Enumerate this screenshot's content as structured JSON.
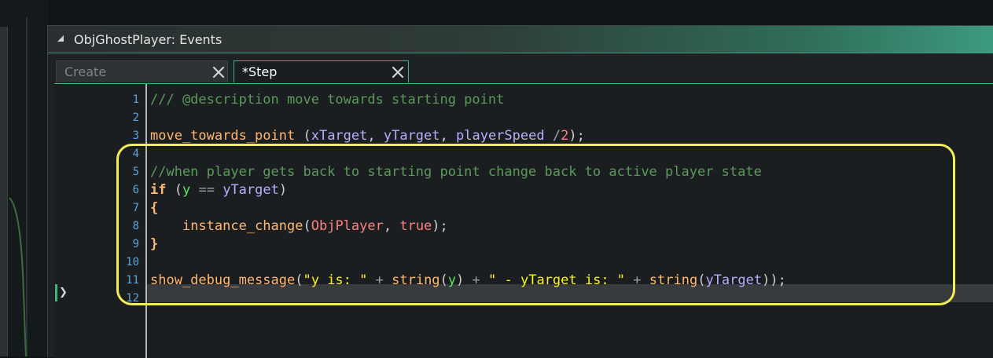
{
  "window": {
    "title": "ObjGhostPlayer: Events"
  },
  "tabs": [
    {
      "label": "Create",
      "active": false
    },
    {
      "label": "*Step",
      "active": true
    }
  ],
  "editor": {
    "line_numbers": [
      "1",
      "2",
      "3",
      "4",
      "5",
      "6",
      "7",
      "8",
      "9",
      "10",
      "11",
      "12"
    ],
    "current_line": 12,
    "lines": [
      [
        {
          "t": "comment",
          "v": "/// @description move towards starting point"
        }
      ],
      [],
      [
        {
          "t": "func",
          "v": "move_towards_point"
        },
        {
          "t": "plain",
          "v": " ("
        },
        {
          "t": "var",
          "v": "xTarget"
        },
        {
          "t": "plain",
          "v": ", "
        },
        {
          "t": "var",
          "v": "yTarget"
        },
        {
          "t": "plain",
          "v": ", "
        },
        {
          "t": "var",
          "v": "playerSpeed"
        },
        {
          "t": "plain",
          "v": " "
        },
        {
          "t": "op",
          "v": "/"
        },
        {
          "t": "num",
          "v": "2"
        },
        {
          "t": "plain",
          "v": ");"
        }
      ],
      [],
      [
        {
          "t": "comment",
          "v": "//when player gets back to starting point change back to active player state"
        }
      ],
      [
        {
          "t": "keyword",
          "v": "if"
        },
        {
          "t": "plain",
          "v": " ("
        },
        {
          "t": "builtin",
          "v": "y"
        },
        {
          "t": "plain",
          "v": " "
        },
        {
          "t": "op",
          "v": "=="
        },
        {
          "t": "plain",
          "v": " "
        },
        {
          "t": "var",
          "v": "yTarget"
        },
        {
          "t": "plain",
          "v": ")"
        }
      ],
      [
        {
          "t": "keyword",
          "v": "{"
        }
      ],
      [
        {
          "t": "plain",
          "v": "    "
        },
        {
          "t": "func",
          "v": "instance_change"
        },
        {
          "t": "plain",
          "v": "("
        },
        {
          "t": "asset",
          "v": "ObjPlayer"
        },
        {
          "t": "plain",
          "v": ", "
        },
        {
          "t": "const",
          "v": "true"
        },
        {
          "t": "plain",
          "v": ");"
        }
      ],
      [
        {
          "t": "keyword",
          "v": "}"
        }
      ],
      [],
      [
        {
          "t": "func",
          "v": "show_debug_message"
        },
        {
          "t": "plain",
          "v": "("
        },
        {
          "t": "string",
          "v": "\"y is: \""
        },
        {
          "t": "plain",
          "v": " "
        },
        {
          "t": "op",
          "v": "+"
        },
        {
          "t": "plain",
          "v": " "
        },
        {
          "t": "func",
          "v": "string"
        },
        {
          "t": "plain",
          "v": "("
        },
        {
          "t": "builtin",
          "v": "y"
        },
        {
          "t": "plain",
          "v": ") "
        },
        {
          "t": "op",
          "v": "+"
        },
        {
          "t": "plain",
          "v": " "
        },
        {
          "t": "string",
          "v": "\" - yTarget is: \""
        },
        {
          "t": "plain",
          "v": " "
        },
        {
          "t": "op",
          "v": "+"
        },
        {
          "t": "plain",
          "v": " "
        },
        {
          "t": "func",
          "v": "string"
        },
        {
          "t": "plain",
          "v": "("
        },
        {
          "t": "var",
          "v": "yTarget"
        },
        {
          "t": "plain",
          "v": "));"
        }
      ],
      []
    ]
  },
  "colors": {
    "accent": "#3ab77a",
    "highlight_box": "#f2ee55",
    "line_numbers": "#5aa3d8"
  },
  "icons": {
    "collapse": "collapse-triangle-icon",
    "tab_close": "close-x-icon",
    "current_line": "current-line-arrow-icon"
  }
}
